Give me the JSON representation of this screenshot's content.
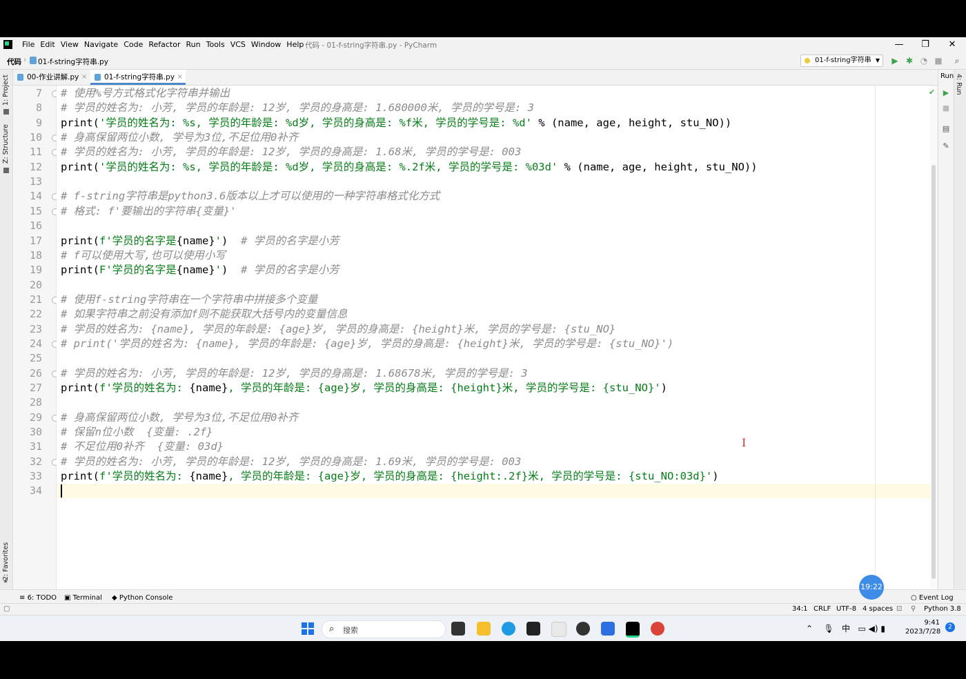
{
  "window": {
    "title": "代码 - 01-f-string字符串.py - PyCharm",
    "menu": [
      "File",
      "Edit",
      "View",
      "Navigate",
      "Code",
      "Refactor",
      "Run",
      "Tools",
      "VCS",
      "Window",
      "Help"
    ],
    "minimize": "—",
    "maximize": "❐",
    "close": "✕"
  },
  "navbar": {
    "project": "代码",
    "file": "01-f-string字符串.py",
    "run_config": "01-f-string字符串"
  },
  "tabs": [
    {
      "label": "00-作业讲解.py",
      "active": false
    },
    {
      "label": "01-f-string字符串.py",
      "active": true
    }
  ],
  "side_panels": {
    "project": "1: Project",
    "structure": "Z: Structure",
    "favorites": "2: Favorites",
    "run": "Run",
    "run_tab": "4: Run"
  },
  "editor": {
    "lines": [
      {
        "n": "7",
        "type": "comment",
        "text": "# 使用%号方式格式化字符串并输出"
      },
      {
        "n": "8",
        "type": "comment",
        "text": "# 学员的姓名为: 小芳, 学员的年龄是: 12岁, 学员的身高是: 1.680000米, 学员的学号是: 3"
      },
      {
        "n": "9",
        "type": "code",
        "pre": "print(",
        "str": "'学员的姓名为: %s, 学员的年龄是: %d岁, 学员的身高是: %f米, 学员的学号是: %d'",
        "post": " % (name, age, height, stu_NO))"
      },
      {
        "n": "10",
        "type": "comment",
        "text": "# 身高保留两位小数, 学号为3位,不足位用0补齐"
      },
      {
        "n": "11",
        "type": "comment",
        "text": "# 学员的姓名为: 小芳, 学员的年龄是: 12岁, 学员的身高是: 1.68米, 学员的学号是: 003"
      },
      {
        "n": "12",
        "type": "code",
        "pre": "print(",
        "str": "'学员的姓名为: %s, 学员的年龄是: %d岁, 学员的身高是: %.2f米, 学员的学号是: %03d'",
        "post": " % (name, age, height, stu_NO))"
      },
      {
        "n": "13",
        "type": "blank",
        "text": ""
      },
      {
        "n": "14",
        "type": "comment",
        "text": "# f-string字符串是python3.6版本以上才可以使用的一种字符串格式化方式"
      },
      {
        "n": "15",
        "type": "comment",
        "text": "# 格式: f'要输出的字符串{变量}'"
      },
      {
        "n": "16",
        "type": "blank",
        "text": ""
      },
      {
        "n": "17",
        "type": "code",
        "pre": "print(",
        "str": "f'学员的名字是",
        "mid": "{name}",
        "str2": "'",
        "post": ")",
        "tail": "  # 学员的名字是小芳"
      },
      {
        "n": "18",
        "type": "comment",
        "text": "# f可以使用大写,也可以使用小写"
      },
      {
        "n": "19",
        "type": "code",
        "pre": "print(",
        "str": "F'学员的名字是",
        "mid": "{name}",
        "str2": "'",
        "post": ")",
        "tail": "  # 学员的名字是小芳"
      },
      {
        "n": "20",
        "type": "blank",
        "text": ""
      },
      {
        "n": "21",
        "type": "comment",
        "text": "# 使用f-string字符串在一个字符串中拼接多个变量"
      },
      {
        "n": "22",
        "type": "comment",
        "text": "# 如果字符串之前没有添加f则不能获取大括号内的变量信息"
      },
      {
        "n": "23",
        "type": "comment",
        "text": "# 学员的姓名为: {name}, 学员的年龄是: {age}岁, 学员的身高是: {height}米, 学员的学号是: {stu_NO}"
      },
      {
        "n": "24",
        "type": "comment",
        "text": "# print('学员的姓名为: {name}, 学员的年龄是: {age}岁, 学员的身高是: {height}米, 学员的学号是: {stu_NO}')"
      },
      {
        "n": "25",
        "type": "blank",
        "text": ""
      },
      {
        "n": "26",
        "type": "comment",
        "text": "# 学员的姓名为: 小芳, 学员的年龄是: 12岁, 学员的身高是: 1.68678米, 学员的学号是: 3"
      },
      {
        "n": "27",
        "type": "code",
        "pre": "print(",
        "str": "f'学员的姓名为: ",
        "mid": "{name}",
        "str2": ", 学员的年龄是: {age}岁, 学员的身高是: {height}米, 学员的学号是: {stu_NO}'",
        "post": ")"
      },
      {
        "n": "28",
        "type": "blank",
        "text": ""
      },
      {
        "n": "29",
        "type": "comment",
        "text": "# 身高保留两位小数, 学号为3位,不足位用0补齐"
      },
      {
        "n": "30",
        "type": "comment",
        "text": "# 保留n位小数  {变量: .2f}"
      },
      {
        "n": "31",
        "type": "comment",
        "text": "# 不足位用0补齐  {变量: 03d}"
      },
      {
        "n": "32",
        "type": "comment",
        "text": "# 学员的姓名为: 小芳, 学员的年龄是: 12岁, 学员的身高是: 1.69米, 学员的学号是: 003"
      },
      {
        "n": "33",
        "type": "code",
        "pre": "print(",
        "str": "f'学员的姓名为: ",
        "mid": "{name}",
        "str2": ", 学员的年龄是: {age}岁, 学员的身高是: {height:.2f}米, 学员的学号是: {stu_NO:03d}'",
        "post": ")"
      },
      {
        "n": "34",
        "type": "blank",
        "text": ""
      }
    ]
  },
  "bottom_tools": {
    "todo": "6: TODO",
    "terminal": "Terminal",
    "python_console": "Python Console",
    "event_log": "Event Log",
    "time_bubble": "19:22"
  },
  "status": {
    "position": "34:1",
    "line_sep": "CRLF",
    "encoding": "UTF-8",
    "indent": "4 spaces",
    "interpreter": "Python 3.8"
  },
  "taskbar": {
    "search_placeholder": "搜索",
    "time": "9:41",
    "date": "2023/7/28",
    "notifications": "2"
  },
  "colors": {
    "comment": "#8c8c8c",
    "string": "#067d17",
    "caret_line": "#fffae3",
    "accent": "#4a88c7"
  }
}
